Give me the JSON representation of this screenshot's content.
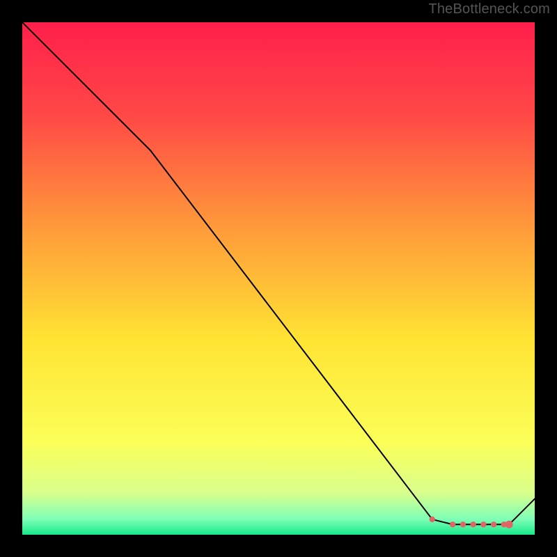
{
  "attribution": "TheBottleneck.com",
  "chart_data": {
    "type": "line",
    "title": "",
    "xlabel": "",
    "ylabel": "",
    "xlim": [
      0,
      100
    ],
    "ylim": [
      0,
      100
    ],
    "x": [
      0,
      25,
      80,
      84,
      95,
      100
    ],
    "values": [
      100,
      75,
      3,
      2,
      2,
      7
    ],
    "annotations": [
      {
        "kind": "dotted_segment",
        "x": [
          80,
          84,
          86,
          88,
          90,
          92,
          94
        ],
        "y": [
          3,
          2,
          2,
          2,
          2,
          2,
          2
        ],
        "color": "#e06666"
      },
      {
        "kind": "dot",
        "x": 95,
        "y": 2,
        "color": "#e06666"
      }
    ],
    "background": {
      "type": "vertical_gradient",
      "stops": [
        {
          "offset": 0.0,
          "color": "#ff1f4b"
        },
        {
          "offset": 0.18,
          "color": "#ff4846"
        },
        {
          "offset": 0.4,
          "color": "#ff9a3a"
        },
        {
          "offset": 0.62,
          "color": "#ffe433"
        },
        {
          "offset": 0.82,
          "color": "#fbff58"
        },
        {
          "offset": 0.92,
          "color": "#d8ff8e"
        },
        {
          "offset": 0.97,
          "color": "#7dffb6"
        },
        {
          "offset": 1.0,
          "color": "#17e88a"
        }
      ]
    }
  }
}
